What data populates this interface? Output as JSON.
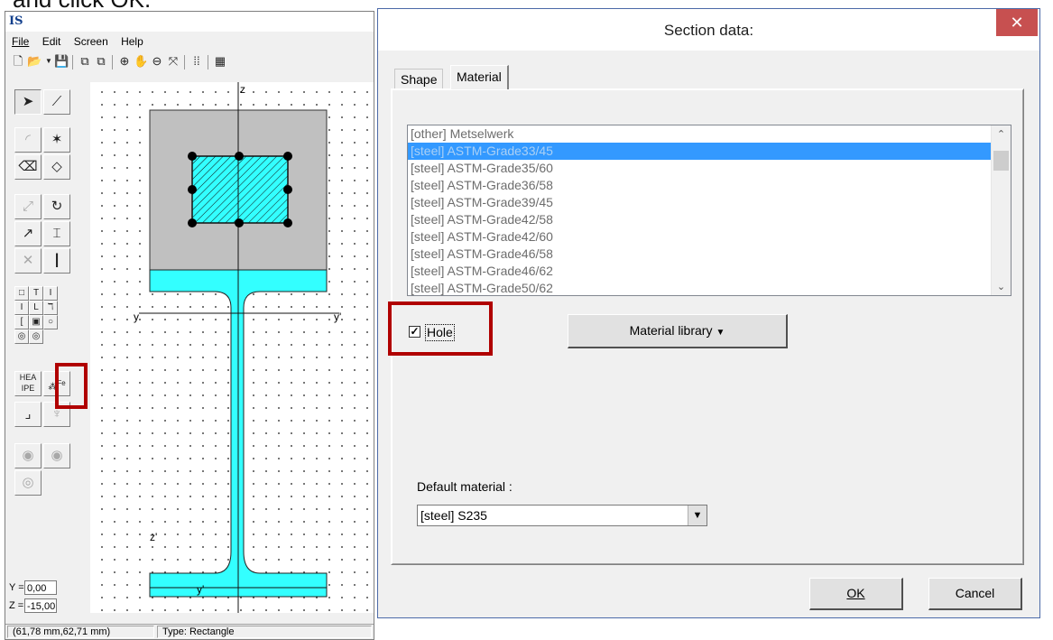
{
  "caption": {
    "text": "and click OK."
  },
  "app": {
    "menu": [
      {
        "label": "File",
        "accel": "F"
      },
      {
        "label": "Edit",
        "accel": "E"
      },
      {
        "label": "Screen",
        "accel": "S"
      },
      {
        "label": "Help",
        "accel": "H"
      }
    ],
    "canvas": {
      "axis_z_top": "z",
      "axis_y_left": "y",
      "axis_y_right": "y'",
      "axis_z_bottom": "z'",
      "axis_y_bottom": "y'"
    },
    "palette": {
      "hea_label_top": "HEA",
      "hea_label_bottom": "IPE",
      "material_button_text": "Fe"
    },
    "coords": {
      "y_label": "Y =",
      "y_value": "0,00",
      "z_label": "Z =",
      "z_value": "-15,00"
    },
    "status": {
      "position": "(61,78 mm,62,71 mm)",
      "type": "Type: Rectangle"
    }
  },
  "dialog": {
    "title": "Section data:",
    "close_glyph": "✕",
    "tabs": [
      {
        "label": "Shape",
        "active": false
      },
      {
        "label": "Material",
        "active": true
      }
    ],
    "materials": [
      {
        "label": "[other] Metselwerk",
        "selected": false
      },
      {
        "label": "[steel] ASTM-Grade33/45",
        "selected": true
      },
      {
        "label": "[steel] ASTM-Grade35/60",
        "selected": false
      },
      {
        "label": "[steel] ASTM-Grade36/58",
        "selected": false
      },
      {
        "label": "[steel] ASTM-Grade39/45",
        "selected": false
      },
      {
        "label": "[steel] ASTM-Grade42/58",
        "selected": false
      },
      {
        "label": "[steel] ASTM-Grade42/60",
        "selected": false
      },
      {
        "label": "[steel] ASTM-Grade46/58",
        "selected": false
      },
      {
        "label": "[steel] ASTM-Grade46/62",
        "selected": false
      },
      {
        "label": "[steel] ASTM-Grade50/62",
        "selected": false
      }
    ],
    "hole": {
      "label": "Hole",
      "checked": true
    },
    "material_library_label": "Material library",
    "default_material_label": "Default material :",
    "default_material_value": "[steel] S235",
    "ok_label": "OK",
    "cancel_label": "Cancel"
  },
  "colors": {
    "section_fill": "#33ffff",
    "hole_fill": "#c0c0c0",
    "highlight": "#b00000",
    "selection": "#3399ff"
  }
}
